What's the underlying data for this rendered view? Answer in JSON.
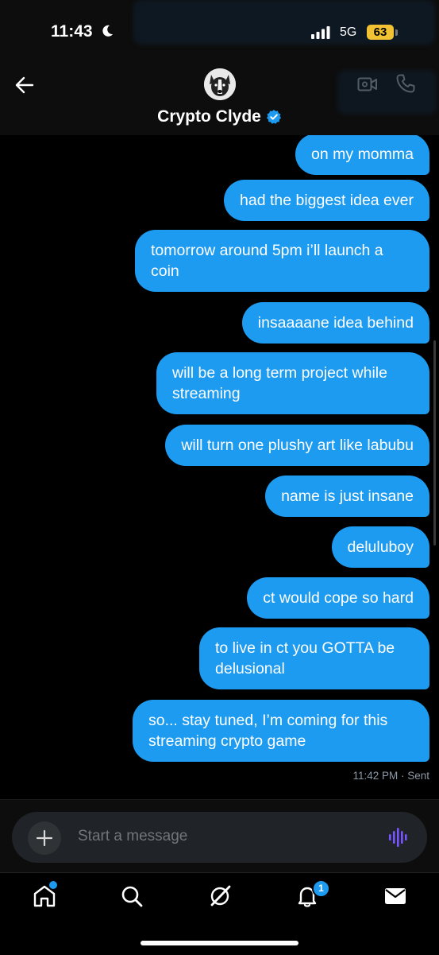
{
  "status_bar": {
    "time": "11:43",
    "network": "5G",
    "battery": "63"
  },
  "header": {
    "contact_name": "Crypto Clyde",
    "verified": true
  },
  "messages": [
    {
      "text": "on my momma"
    },
    {
      "text": "had the biggest idea ever"
    },
    {
      "text": "tomorrow around 5pm i’ll launch a\ncoin"
    },
    {
      "text": "insaaaane idea behind"
    },
    {
      "text": "will be a long term project while\nstreaming"
    },
    {
      "text": "will turn one plushy art like labubu"
    },
    {
      "text": "name is just insane"
    },
    {
      "text": "deluluboy"
    },
    {
      "text": "ct would cope so hard"
    },
    {
      "text": "to live in ct you GOTTA be\ndelusional"
    },
    {
      "text": "so... stay tuned, I’m coming for this\nstreaming crypto game"
    }
  ],
  "last_message_meta": "11:42 PM · Sent",
  "composer": {
    "placeholder": "Start a message"
  },
  "tabbar": {
    "items": [
      "home-icon",
      "search-icon",
      "grok-icon",
      "notifications-icon",
      "messages-icon"
    ],
    "notifications_badge": "1"
  },
  "colors": {
    "accent": "#1d9bf0",
    "background": "#000000",
    "composer": "#202327",
    "voice_icon": "#7856ff"
  }
}
